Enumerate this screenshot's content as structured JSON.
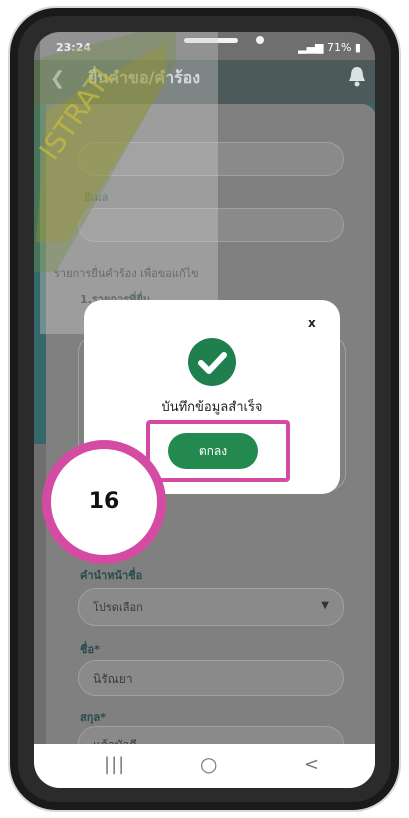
{
  "status_bar": {
    "time": "23:24",
    "battery": "71%"
  },
  "header": {
    "title": "ยื่นคำขอ/คำร้อง"
  },
  "form": {
    "email_label": "อีเมล",
    "request_list_label": "รายการยื่นคำร้อง เพื่อขอแก้ไข",
    "section_label": "1.รายการที่ยื่น",
    "title_prefix_label": "คำนำหน้าชื่อ",
    "title_prefix_placeholder": "โปรดเลือก",
    "first_name_label": "ชื่อ*",
    "first_name_value": "นิรัณยา",
    "last_name_label": "สกุล*",
    "last_name_value": "แก้วบัวดี"
  },
  "modal": {
    "close_label": "x",
    "message": "บันทึกข้อมูลสำเร็จ",
    "ok_label": "ตกลง"
  },
  "annotation": {
    "step_number": "16"
  },
  "colors": {
    "accent_green": "#23894e",
    "highlight_pink": "#d54ba3",
    "teal": "#35686a"
  },
  "nav": {
    "recent": "|||",
    "home": "○",
    "back": "<"
  }
}
